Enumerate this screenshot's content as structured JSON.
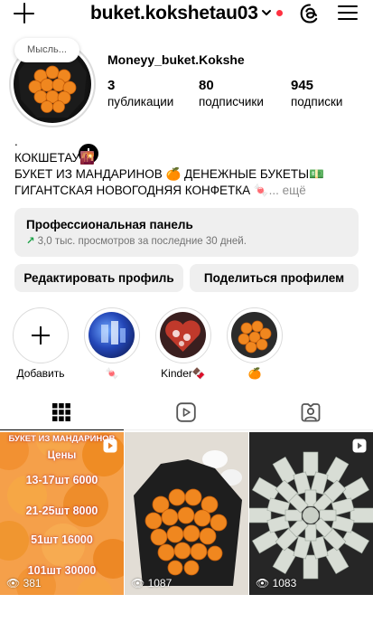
{
  "header": {
    "username": "buket.kokshetau03",
    "icons": [
      "plus-icon",
      "chevron-down-icon",
      "notification-dot",
      "threads-icon",
      "menu-icon"
    ]
  },
  "profile": {
    "note": "Мысль...",
    "display_name": "Moneyy_buket.Kokshe",
    "stats": {
      "posts": {
        "value": "3",
        "label": "публикации"
      },
      "followers": {
        "value": "80",
        "label": "подписчики"
      },
      "following": {
        "value": "945",
        "label": "подписки"
      }
    },
    "bio": {
      "line0": ".",
      "line1": "КОКШЕТАУ🌇",
      "line2": "БУКЕТ ИЗ МАНДАРИНОВ 🍊 ДЕНЕЖНЫЕ БУКЕТЫ💵",
      "line3": "ГИГАНТСКАЯ НОВОГОДНЯЯ КОНФЕТКА 🍬",
      "more": "... ещё"
    }
  },
  "pro_panel": {
    "title": "Профессиональная панель",
    "subtitle": "3,0 тыс. просмотров за последние 30 дней."
  },
  "buttons": {
    "edit": "Редактировать профиль",
    "share": "Поделиться профилем"
  },
  "highlights": [
    {
      "label": "Добавить",
      "icon": "plus-icon"
    },
    {
      "label": "🍬"
    },
    {
      "label": "Kinder🍫"
    },
    {
      "label": "🍊"
    }
  ],
  "tabs": [
    "grid-icon",
    "reels-icon",
    "tagged-icon"
  ],
  "posts": [
    {
      "views": "381",
      "overlay_lines": [
        "БУКЕТ ИЗ МАНДАРИНОВ",
        "Цены",
        "13-17шт 6000",
        "21-25шт 8000",
        "51шт 16000",
        "101шт 30000"
      ]
    },
    {
      "views": "1087"
    },
    {
      "views": "1083"
    }
  ],
  "colors": {
    "accent_red": "#ff3040",
    "panel_bg": "#efefef",
    "growth_green": "#1fa34a",
    "muted": "#737373"
  }
}
